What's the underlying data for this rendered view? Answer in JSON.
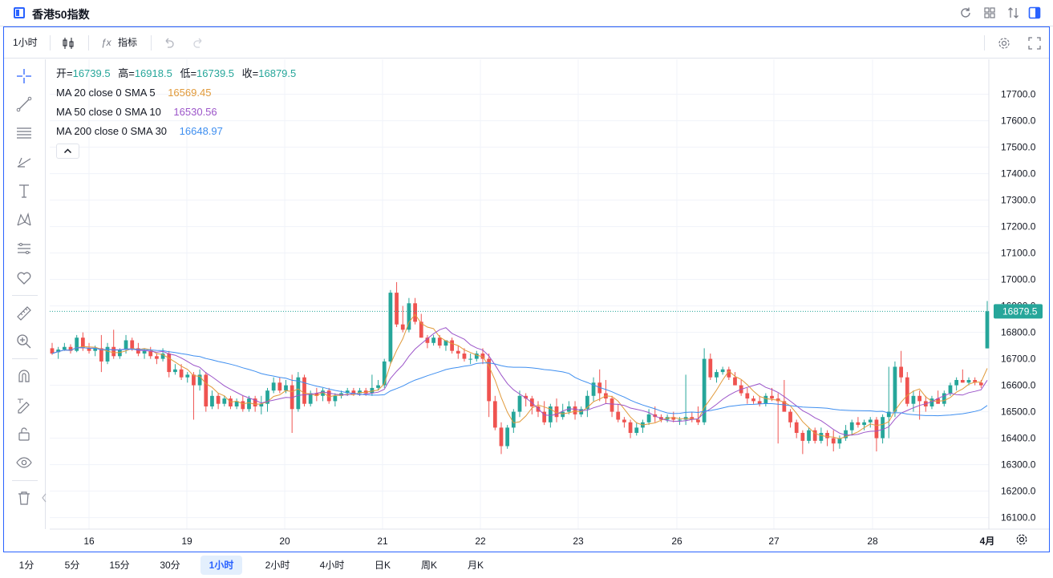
{
  "window": {
    "title": "香港50指数"
  },
  "toolbar": {
    "interval": "1小时",
    "indicators": "指标"
  },
  "legend": {
    "ohlc": {
      "open_label": "开=",
      "open": "16739.5",
      "high_label": "高=",
      "high": "16918.5",
      "low_label": "低=",
      "low": "16739.5",
      "close_label": "收=",
      "close": "16879.5"
    },
    "ma": [
      {
        "label": "MA 20 close 0 SMA 5",
        "value": "16569.45",
        "color": "#e19a3b"
      },
      {
        "label": "MA 50 close 0 SMA 10",
        "value": "16530.56",
        "color": "#9c55c9"
      },
      {
        "label": "MA 200 close 0 SMA 30",
        "value": "16648.97",
        "color": "#3f8ff0"
      }
    ]
  },
  "chart_data": {
    "type": "candlestick",
    "y_axis_ticks": [
      "17700.0",
      "17600.0",
      "17500.0",
      "17400.0",
      "17300.0",
      "17200.0",
      "17100.0",
      "17000.0",
      "16900.0",
      "16800.0",
      "16700.0",
      "16600.0",
      "16500.0",
      "16400.0",
      "16300.0",
      "16200.0",
      "16100.0"
    ],
    "x_axis_ticks": [
      "16",
      "19",
      "20",
      "21",
      "22",
      "23",
      "26",
      "27",
      "28",
      "4月"
    ],
    "last_price_label": "16879.5",
    "up_color": "#26a69a",
    "down_color": "#ef5350",
    "ylim": [
      16020,
      17800
    ],
    "candles": [
      [
        16740,
        16760,
        16715,
        16720
      ],
      [
        16725,
        16745,
        16700,
        16735
      ],
      [
        16735,
        16760,
        16730,
        16745
      ],
      [
        16745,
        16755,
        16720,
        16730
      ],
      [
        16730,
        16790,
        16725,
        16780
      ],
      [
        16780,
        16800,
        16730,
        16740
      ],
      [
        16740,
        16760,
        16720,
        16730
      ],
      [
        16730,
        16750,
        16710,
        16740
      ],
      [
        16740,
        16790,
        16650,
        16690
      ],
      [
        16690,
        16760,
        16680,
        16745
      ],
      [
        16745,
        16810,
        16700,
        16710
      ],
      [
        16710,
        16740,
        16700,
        16735
      ],
      [
        16735,
        16790,
        16720,
        16770
      ],
      [
        16770,
        16780,
        16730,
        16740
      ],
      [
        16740,
        16760,
        16710,
        16720
      ],
      [
        16720,
        16740,
        16700,
        16730
      ],
      [
        16730,
        16745,
        16700,
        16710
      ],
      [
        16710,
        16720,
        16680,
        16700
      ],
      [
        16700,
        16740,
        16690,
        16720
      ],
      [
        16720,
        16730,
        16630,
        16650
      ],
      [
        16650,
        16680,
        16640,
        16660
      ],
      [
        16660,
        16680,
        16620,
        16630
      ],
      [
        16630,
        16650,
        16610,
        16640
      ],
      [
        16640,
        16650,
        16470,
        16600
      ],
      [
        16600,
        16660,
        16580,
        16640
      ],
      [
        16640,
        16650,
        16500,
        16520
      ],
      [
        16520,
        16580,
        16510,
        16560
      ],
      [
        16560,
        16570,
        16510,
        16530
      ],
      [
        16530,
        16560,
        16520,
        16550
      ],
      [
        16550,
        16560,
        16510,
        16520
      ],
      [
        16520,
        16550,
        16510,
        16540
      ],
      [
        16540,
        16560,
        16500,
        16510
      ],
      [
        16510,
        16560,
        16500,
        16550
      ],
      [
        16550,
        16560,
        16500,
        16520
      ],
      [
        16520,
        16560,
        16490,
        16530
      ],
      [
        16530,
        16590,
        16500,
        16580
      ],
      [
        16580,
        16630,
        16570,
        16610
      ],
      [
        16610,
        16630,
        16570,
        16580
      ],
      [
        16580,
        16620,
        16570,
        16600
      ],
      [
        16600,
        16640,
        16420,
        16510
      ],
      [
        16510,
        16650,
        16500,
        16630
      ],
      [
        16630,
        16640,
        16520,
        16530
      ],
      [
        16530,
        16580,
        16520,
        16570
      ],
      [
        16570,
        16590,
        16540,
        16560
      ],
      [
        16560,
        16590,
        16540,
        16580
      ],
      [
        16580,
        16590,
        16530,
        16540
      ],
      [
        16540,
        16570,
        16520,
        16560
      ],
      [
        16560,
        16580,
        16550,
        16570
      ],
      [
        16570,
        16590,
        16560,
        16580
      ],
      [
        16580,
        16590,
        16560,
        16570
      ],
      [
        16570,
        16590,
        16560,
        16580
      ],
      [
        16580,
        16590,
        16560,
        16570
      ],
      [
        16570,
        16640,
        16560,
        16590
      ],
      [
        16590,
        16620,
        16580,
        16600
      ],
      [
        16600,
        16700,
        16590,
        16690
      ],
      [
        16690,
        16960,
        16680,
        16950
      ],
      [
        16950,
        16990,
        16820,
        16830
      ],
      [
        16830,
        16900,
        16800,
        16810
      ],
      [
        16810,
        16930,
        16800,
        16910
      ],
      [
        16910,
        16930,
        16830,
        16840
      ],
      [
        16840,
        16870,
        16780,
        16780
      ],
      [
        16780,
        16790,
        16740,
        16760
      ],
      [
        16760,
        16790,
        16750,
        16780
      ],
      [
        16780,
        16790,
        16740,
        16750
      ],
      [
        16750,
        16770,
        16730,
        16770
      ],
      [
        16770,
        16780,
        16720,
        16730
      ],
      [
        16730,
        16750,
        16700,
        16720
      ],
      [
        16720,
        16740,
        16690,
        16700
      ],
      [
        16700,
        16720,
        16680,
        16700
      ],
      [
        16700,
        16730,
        16690,
        16720
      ],
      [
        16720,
        16740,
        16680,
        16700
      ],
      [
        16700,
        16720,
        16480,
        16540
      ],
      [
        16540,
        16560,
        16430,
        16440
      ],
      [
        16440,
        16460,
        16340,
        16370
      ],
      [
        16370,
        16450,
        16360,
        16440
      ],
      [
        16440,
        16510,
        16420,
        16500
      ],
      [
        16500,
        16580,
        16480,
        16560
      ],
      [
        16560,
        16570,
        16520,
        16550
      ],
      [
        16550,
        16560,
        16490,
        16520
      ],
      [
        16520,
        16540,
        16480,
        16500
      ],
      [
        16500,
        16540,
        16450,
        16460
      ],
      [
        16460,
        16530,
        16440,
        16520
      ],
      [
        16520,
        16550,
        16460,
        16480
      ],
      [
        16480,
        16530,
        16470,
        16500
      ],
      [
        16500,
        16540,
        16490,
        16520
      ],
      [
        16520,
        16540,
        16470,
        16490
      ],
      [
        16490,
        16520,
        16480,
        16510
      ],
      [
        16510,
        16580,
        16480,
        16560
      ],
      [
        16560,
        16630,
        16540,
        16610
      ],
      [
        16610,
        16660,
        16540,
        16570
      ],
      [
        16570,
        16620,
        16530,
        16550
      ],
      [
        16550,
        16560,
        16480,
        16500
      ],
      [
        16500,
        16530,
        16460,
        16470
      ],
      [
        16470,
        16480,
        16440,
        16460
      ],
      [
        16460,
        16470,
        16400,
        16420
      ],
      [
        16420,
        16460,
        16410,
        16440
      ],
      [
        16440,
        16470,
        16420,
        16460
      ],
      [
        16460,
        16510,
        16450,
        16490
      ],
      [
        16490,
        16520,
        16460,
        16480
      ],
      [
        16480,
        16490,
        16460,
        16470
      ],
      [
        16470,
        16490,
        16460,
        16480
      ],
      [
        16480,
        16500,
        16460,
        16470
      ],
      [
        16470,
        16480,
        16450,
        16470
      ],
      [
        16470,
        16640,
        16450,
        16480
      ],
      [
        16480,
        16500,
        16460,
        16470
      ],
      [
        16470,
        16520,
        16450,
        16460
      ],
      [
        16460,
        16740,
        16450,
        16700
      ],
      [
        16700,
        16720,
        16620,
        16630
      ],
      [
        16630,
        16660,
        16610,
        16650
      ],
      [
        16650,
        16670,
        16640,
        16660
      ],
      [
        16660,
        16670,
        16620,
        16630
      ],
      [
        16630,
        16650,
        16600,
        16600
      ],
      [
        16600,
        16620,
        16560,
        16570
      ],
      [
        16570,
        16590,
        16530,
        16550
      ],
      [
        16550,
        16560,
        16530,
        16540
      ],
      [
        16540,
        16560,
        16520,
        16530
      ],
      [
        16530,
        16570,
        16520,
        16560
      ],
      [
        16560,
        16590,
        16540,
        16550
      ],
      [
        16550,
        16570,
        16380,
        16540
      ],
      [
        16540,
        16620,
        16530,
        16500
      ],
      [
        16500,
        16510,
        16440,
        16460
      ],
      [
        16460,
        16470,
        16400,
        16420
      ],
      [
        16420,
        16430,
        16340,
        16390
      ],
      [
        16390,
        16440,
        16380,
        16430
      ],
      [
        16430,
        16440,
        16380,
        16390
      ],
      [
        16390,
        16440,
        16380,
        16420
      ],
      [
        16420,
        16430,
        16370,
        16400
      ],
      [
        16400,
        16430,
        16350,
        16380
      ],
      [
        16380,
        16410,
        16360,
        16400
      ],
      [
        16400,
        16450,
        16390,
        16430
      ],
      [
        16430,
        16470,
        16410,
        16460
      ],
      [
        16460,
        16480,
        16440,
        16450
      ],
      [
        16450,
        16470,
        16430,
        16460
      ],
      [
        16460,
        16480,
        16440,
        16470
      ],
      [
        16470,
        16480,
        16350,
        16400
      ],
      [
        16400,
        16490,
        16380,
        16480
      ],
      [
        16480,
        16670,
        16400,
        16500
      ],
      [
        16500,
        16690,
        16480,
        16670
      ],
      [
        16670,
        16730,
        16610,
        16630
      ],
      [
        16630,
        16650,
        16520,
        16530
      ],
      [
        16530,
        16580,
        16500,
        16560
      ],
      [
        16560,
        16580,
        16470,
        16540
      ],
      [
        16540,
        16560,
        16500,
        16520
      ],
      [
        16520,
        16560,
        16510,
        16550
      ],
      [
        16550,
        16580,
        16530,
        16530
      ],
      [
        16530,
        16580,
        16520,
        16570
      ],
      [
        16570,
        16610,
        16560,
        16600
      ],
      [
        16600,
        16630,
        16580,
        16620
      ],
      [
        16620,
        16660,
        16610,
        16610
      ],
      [
        16610,
        16630,
        16600,
        16620
      ],
      [
        16620,
        16630,
        16600,
        16610
      ],
      [
        16610,
        16620,
        16590,
        16600
      ],
      [
        16739.5,
        16918.5,
        16739.5,
        16879.5
      ]
    ]
  },
  "bottombar": {
    "intervals": [
      "1分",
      "5分",
      "15分",
      "30分",
      "1小时",
      "2小时",
      "4小时",
      "日K",
      "周K",
      "月K"
    ],
    "active": "1小时"
  }
}
